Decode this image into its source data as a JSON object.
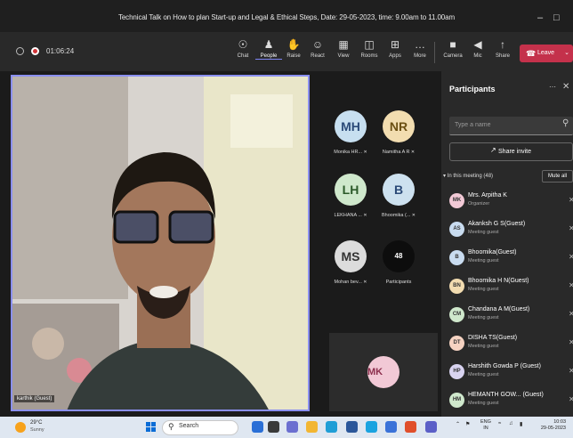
{
  "window": {
    "title": "Technical Talk on How to plan Start-up and Legal & Ethical Steps, Date: 29-05-2023, time: 9.00am to 11.00am"
  },
  "toolbar": {
    "timer": "01:06:24",
    "buttons": [
      {
        "label": "Chat",
        "icon": "chat-icon",
        "glyph": "☉"
      },
      {
        "label": "People",
        "icon": "people-icon",
        "glyph": "♟"
      },
      {
        "label": "Raise",
        "icon": "raise-hand-icon",
        "glyph": "✋"
      },
      {
        "label": "React",
        "icon": "react-icon",
        "glyph": "☺"
      },
      {
        "label": "View",
        "icon": "view-icon",
        "glyph": "▦"
      },
      {
        "label": "Rooms",
        "icon": "rooms-icon",
        "glyph": "◫"
      },
      {
        "label": "Apps",
        "icon": "apps-icon",
        "glyph": "⊞"
      },
      {
        "label": "More",
        "icon": "more-icon",
        "glyph": "…"
      },
      {
        "label": "Camera",
        "icon": "camera-off-icon",
        "glyph": "■"
      },
      {
        "label": "Mic",
        "icon": "mic-icon",
        "glyph": "◀"
      },
      {
        "label": "Share",
        "icon": "share-icon",
        "glyph": "↑"
      }
    ],
    "leave_label": "Leave"
  },
  "stage": {
    "caption": "karthik (Guest)",
    "tiles": [
      {
        "initials": "MH",
        "name": "Monika HR...",
        "color": "#c7dff0",
        "text": "#2b4a78"
      },
      {
        "initials": "NR",
        "name": "Namitha A R",
        "color": "#f2ddb0",
        "text": "#6b4f12"
      },
      {
        "initials": "LH",
        "name": "LEKHANA ...",
        "color": "#cfe8cc",
        "text": "#2c5a2a"
      },
      {
        "initials": "B",
        "name": "Bhoomika (...",
        "color": "#cde1ef",
        "text": "#2b4a78"
      },
      {
        "initials": "MS",
        "name": "Mohan bev...",
        "color": "#dcdcdc",
        "text": "#333"
      },
      {
        "initials": "48",
        "name": "Participants",
        "color": "#0d0d0d",
        "text": "#fff"
      }
    ],
    "bottom_tile_initials": "MK"
  },
  "panel": {
    "title": "Participants",
    "search_placeholder": "Type a name",
    "share_label": "Share invite",
    "in_meeting": "In this meeting (48)",
    "mute_all": "Mute all",
    "participants": [
      {
        "initials": "MK",
        "name": "Mrs. Arpitha K",
        "role": "Organizer",
        "color": "#f2c9d6"
      },
      {
        "initials": "AS",
        "name": "Akanksh G S(Guest)",
        "role": "Meeting guest",
        "color": "#c9dcf0"
      },
      {
        "initials": "B",
        "name": "Bhoomika(Guest)",
        "role": "Meeting guest",
        "color": "#c9dcf0"
      },
      {
        "initials": "BN",
        "name": "Bhoomika H N(Guest)",
        "role": "Meeting guest",
        "color": "#f2dcb0"
      },
      {
        "initials": "CM",
        "name": "Chandana A M(Guest)",
        "role": "Meeting guest",
        "color": "#cfe8cc"
      },
      {
        "initials": "DT",
        "name": "DISHA TS(Guest)",
        "role": "Meeting guest",
        "color": "#f6d3c2"
      },
      {
        "initials": "HP",
        "name": "Harshith Gowda P (Guest)",
        "role": "Meeting guest",
        "color": "#d8d3f0"
      },
      {
        "initials": "HM",
        "name": "HEMANTH GOW... (Guest)",
        "role": "Meeting guest",
        "color": "#cfe8cc"
      }
    ]
  },
  "taskbar": {
    "temp": "29°C",
    "weather": "Sunny",
    "search_label": "Search",
    "lang_top": "ENG",
    "lang_bottom": "IN",
    "time": "10:03",
    "date": "29-05-2023"
  }
}
